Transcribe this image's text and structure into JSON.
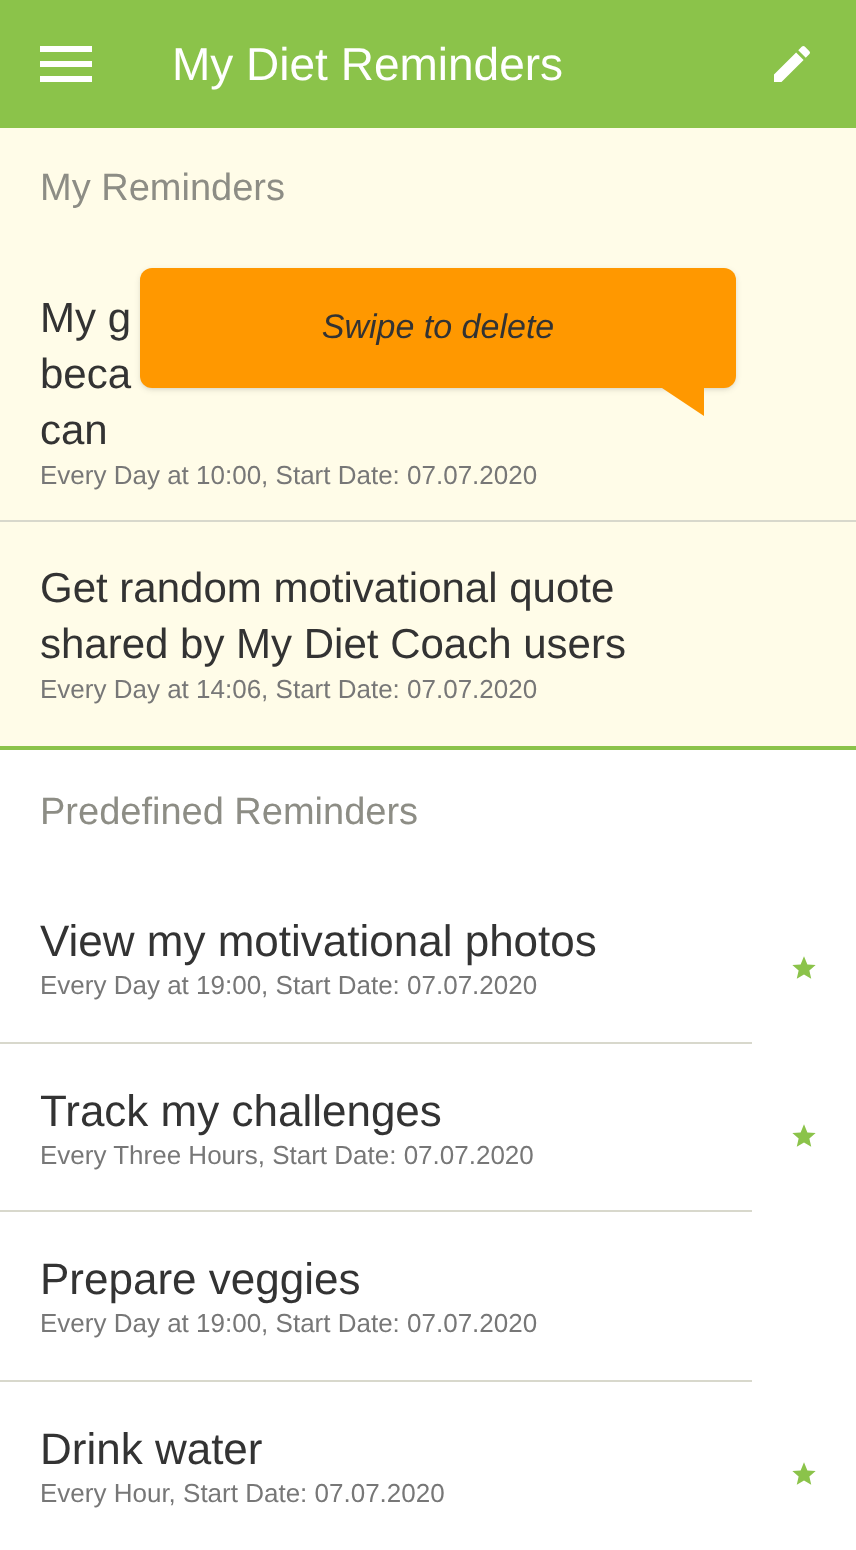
{
  "app_bar": {
    "title": "My Diet Reminders"
  },
  "my_reminders": {
    "heading": "My Reminders",
    "items": [
      {
        "title_lines": [
          "My g",
          "beca",
          "can"
        ],
        "schedule": "Every Day at 10:00, Start Date: 07.07.2020"
      },
      {
        "title_lines": [
          "Get random motivational quote",
          "shared by My Diet Coach users"
        ],
        "schedule": "Every Day at 14:06, Start Date: 07.07.2020"
      }
    ]
  },
  "tooltip": {
    "text": "Swipe to delete"
  },
  "predefined_reminders": {
    "heading": "Predefined Reminders",
    "items": [
      {
        "title": "View my motivational photos",
        "schedule": "Every Day at 19:00, Start Date: 07.07.2020",
        "starred": true
      },
      {
        "title": "Track my challenges",
        "schedule": "Every Three Hours,  Start Date: 07.07.2020",
        "starred": true
      },
      {
        "title": "Prepare veggies",
        "schedule": "Every Day at 19:00, Start Date: 07.07.2020",
        "starred": false
      },
      {
        "title": "Drink water",
        "schedule": "Every Hour,  Start Date: 07.07.2020",
        "starred": true
      }
    ]
  }
}
